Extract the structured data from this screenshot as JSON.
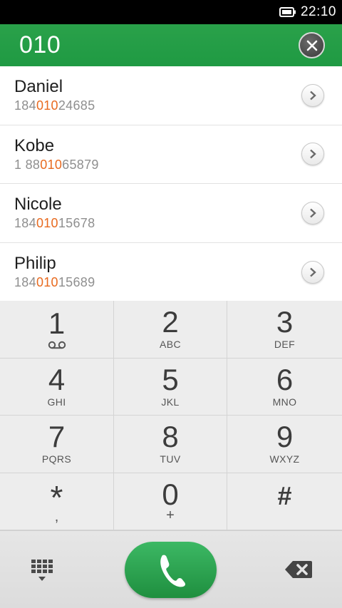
{
  "status_bar": {
    "time": "22:10",
    "battery_icon": "battery-icon"
  },
  "dialer": {
    "input_value": "010",
    "clear_icon": "close-icon"
  },
  "contacts": [
    {
      "name": "Daniel",
      "number_prefix": "184",
      "number_match": "010",
      "number_suffix": "24685"
    },
    {
      "name": "Kobe",
      "number_prefix": "1 88",
      "number_match": "010",
      "number_suffix": "65879"
    },
    {
      "name": "Nicole",
      "number_prefix": "184",
      "number_match": "010",
      "number_suffix": "15678"
    },
    {
      "name": "Philip",
      "number_prefix": "184",
      "number_match": "010",
      "number_suffix": "15689"
    }
  ],
  "keypad": [
    {
      "digit": "1",
      "letters": "",
      "sub_icon": "voicemail-icon"
    },
    {
      "digit": "2",
      "letters": "ABC"
    },
    {
      "digit": "3",
      "letters": "DEF"
    },
    {
      "digit": "4",
      "letters": "GHI"
    },
    {
      "digit": "5",
      "letters": "JKL"
    },
    {
      "digit": "6",
      "letters": "MNO"
    },
    {
      "digit": "7",
      "letters": "PQRS"
    },
    {
      "digit": "8",
      "letters": "TUV"
    },
    {
      "digit": "9",
      "letters": "WXYZ"
    },
    {
      "digit": "*",
      "letters": ","
    },
    {
      "digit": "0",
      "letters": "+"
    },
    {
      "digit": "#",
      "letters": ""
    }
  ],
  "bottom_bar": {
    "left_icon": "dialpad-icon",
    "center_icon": "phone-icon",
    "right_icon": "backspace-icon"
  },
  "colors": {
    "accent": "#22a04a",
    "highlight": "#e86a1f",
    "call_button": "#2ca856"
  }
}
